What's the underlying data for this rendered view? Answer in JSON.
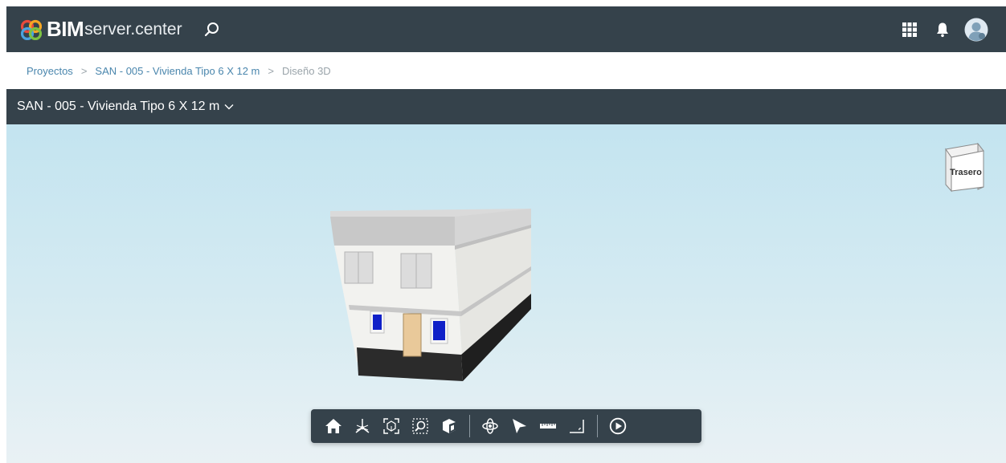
{
  "header": {
    "brand_strong": "BIM",
    "brand_light": "server.center"
  },
  "breadcrumb": {
    "items": [
      {
        "label": "Proyectos"
      },
      {
        "label": "SAN - 005 - Vivienda Tipo  6 X 12 m"
      },
      {
        "label": "Diseño 3D"
      }
    ],
    "separator": ">"
  },
  "project": {
    "title": "SAN - 005 - Vivienda Tipo 6 X 12 m"
  },
  "viewer": {
    "viewcube_label": "Trasero"
  },
  "colors": {
    "header_bg": "#35424b",
    "link": "#4a86ad",
    "sky_top": "#c3e4f0",
    "sky_bottom": "#e9f1f4"
  },
  "toolbar": {
    "icons": [
      "home-icon",
      "axes-view-icon",
      "zoom-extents-icon",
      "zoom-window-icon",
      "section-box-icon",
      "orbit-icon",
      "select-pointer-icon",
      "measure-ruler-icon",
      "dimension-icon",
      "play-icon"
    ]
  }
}
